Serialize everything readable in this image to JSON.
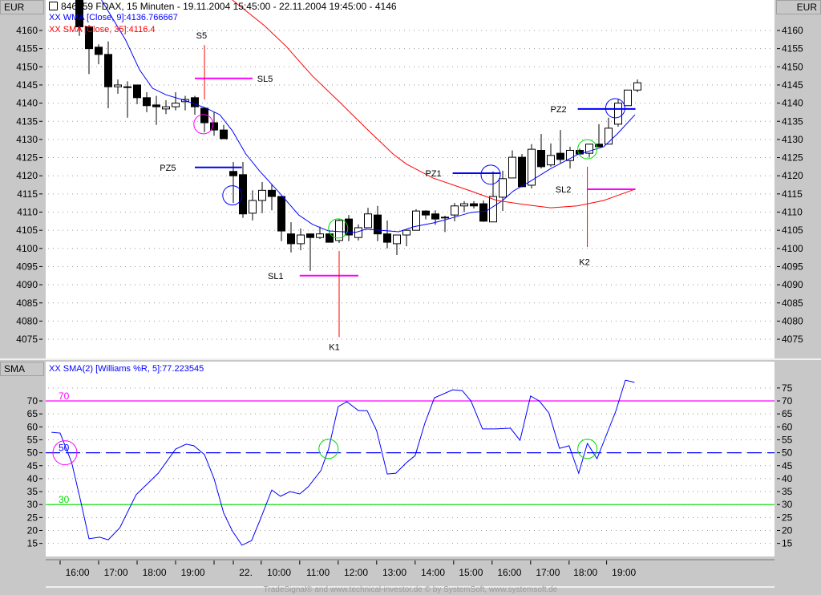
{
  "header": {
    "symbol_icon": "crosshair-icon",
    "title": "846959  FDAX, 15 Minuten - 19.11.2004 15:45:00 - 22.11.2004 19:45:00 - 4146",
    "wma_legend": "XX WMA [Close, 9]:4136.766667",
    "sma_legend": "XX SMA [Close, 35]:4116.4",
    "currency_left": "EUR",
    "currency_right": "EUR"
  },
  "lower_panel": {
    "label": "SMA",
    "legend": "XX SMA(2) [Williams %R, 5]:77.223545"
  },
  "footer": "TradeSignal® and www.technical-investor.de © by  SystemSoft, www.systemsoft.de",
  "colors": {
    "wma": "#0000ff",
    "sma": "#ff0000",
    "magenta": "#ff00ff",
    "green": "#00dd00",
    "blue": "#0000ff",
    "red": "#ff0000"
  },
  "chart_data": [
    {
      "type": "candlestick",
      "title": "FDAX, 15 Minuten",
      "ylabel": "EUR",
      "ylim": [
        4071,
        4168
      ],
      "yticks": [
        4160,
        4155,
        4150,
        4145,
        4140,
        4135,
        4130,
        4125,
        4120,
        4115,
        4110,
        4105,
        4100,
        4095,
        4090,
        4085,
        4080,
        4075
      ],
      "grid": true,
      "ohlc_fields": [
        "open",
        "high",
        "low",
        "close"
      ],
      "candles": [
        [
          4170,
          4172,
          4158.5,
          4161
        ],
        [
          4161,
          4161.5,
          4148,
          4155
        ],
        [
          4155.4,
          4156.2,
          4150.7,
          4153.4
        ],
        [
          4153.4,
          4157,
          4138.6,
          4144.5
        ],
        [
          4144.5,
          4146.5,
          4142.6,
          4145
        ],
        [
          4144.5,
          4146,
          4136,
          4144.5
        ],
        [
          4145,
          4145,
          4139.7,
          4141.5
        ],
        [
          4141.5,
          4143,
          4137.5,
          4139.3
        ],
        [
          4139.5,
          4142,
          4134,
          4139
        ],
        [
          4138.4,
          4140.8,
          4137,
          4139
        ],
        [
          4139,
          4143,
          4138,
          4140
        ],
        [
          4140.4,
          4142,
          4138,
          4141
        ],
        [
          4141.5,
          4142,
          4136.8,
          4139
        ],
        [
          4138.6,
          4138.6,
          4132,
          4134.6
        ],
        [
          4134.6,
          4137.5,
          4131,
          4132.6
        ],
        [
          4132.6,
          4134,
          4130.2,
          4130.2
        ],
        [
          4121.2,
          4123.8,
          4112.5,
          4120
        ],
        [
          4120.3,
          4123.8,
          4108.4,
          4109.5
        ],
        [
          4109.7,
          4116,
          4107.7,
          4113.2
        ],
        [
          4113.2,
          4118.3,
          4109.7,
          4116
        ],
        [
          4116,
          4117.6,
          4110.5,
          4114.3
        ],
        [
          4114.3,
          4114.3,
          4102,
          4104.8
        ],
        [
          4104,
          4107.2,
          4098.9,
          4101.3
        ],
        [
          4101.3,
          4105.5,
          4099.5,
          4103.7
        ],
        [
          4104,
          4104,
          4093.8,
          4103
        ],
        [
          4103,
          4106,
          4102.6,
          4104
        ],
        [
          4104,
          4105,
          4101.7,
          4101.7
        ],
        [
          4102.2,
          4108.1,
          4101.5,
          4107.7
        ],
        [
          4108.1,
          4109.2,
          4102,
          4103.7
        ],
        [
          4103,
          4106.6,
          4102.2,
          4105.7
        ],
        [
          4105.7,
          4111.2,
          4105.7,
          4109.5
        ],
        [
          4109.2,
          4111.7,
          4102,
          4104
        ],
        [
          4104,
          4107.7,
          4100,
          4101.7
        ],
        [
          4101.3,
          4103.7,
          4098.2,
          4103.7
        ],
        [
          4103.7,
          4105,
          4100.6,
          4105
        ],
        [
          4105,
          4110.8,
          4105,
          4110.3
        ],
        [
          4110.3,
          4110.5,
          4108,
          4109.2
        ],
        [
          4109.5,
          4110.5,
          4106.5,
          4108.1
        ],
        [
          4108.6,
          4109,
          4104.5,
          4108.6
        ],
        [
          4109.2,
          4112.5,
          4107.5,
          4111.7
        ],
        [
          4111.7,
          4113,
          4110,
          4112.3
        ],
        [
          4112.3,
          4113,
          4111,
          4111.7
        ],
        [
          4112.3,
          4113.2,
          4107.3,
          4107.5
        ],
        [
          4107.3,
          4121.2,
          4107.3,
          4114.3
        ],
        [
          4114.1,
          4121.4,
          4110.3,
          4119.2
        ],
        [
          4119.4,
          4127,
          4119.4,
          4125.1
        ],
        [
          4125.1,
          4126,
          4116.8,
          4117
        ],
        [
          4117.4,
          4128.7,
          4116.5,
          4127.3
        ],
        [
          4127,
          4131.5,
          4122,
          4122.5
        ],
        [
          4123,
          4128.9,
          4122.5,
          4125.6
        ],
        [
          4126.2,
          4132.6,
          4123.5,
          4124.5
        ],
        [
          4124.2,
          4128,
          4122,
          4127
        ],
        [
          4127,
          4127.5,
          4125.5,
          4126
        ],
        [
          4126.2,
          4128.7,
          4125,
          4128.7
        ],
        [
          4128.7,
          4134.2,
          4128,
          4128
        ],
        [
          4128.7,
          4136,
          4128.7,
          4133.1
        ],
        [
          4134.2,
          4141,
          4133.5,
          4140
        ],
        [
          4139.3,
          4143.6,
          4139.3,
          4143.6
        ],
        [
          4143.6,
          4146.5,
          4143,
          4145.6
        ]
      ],
      "series": [
        {
          "name": "WMA [Close, 9]",
          "color": "#0000ff",
          "points": [
            [
              2.3,
              4168.4
            ],
            [
              4.8,
              4157.4
            ],
            [
              6.25,
              4149.2
            ],
            [
              7.6,
              4144.1
            ],
            [
              9,
              4142.3
            ],
            [
              10.9,
              4140.8
            ],
            [
              13.2,
              4138.6
            ],
            [
              14.6,
              4136.8
            ],
            [
              15.9,
              4132.4
            ],
            [
              17.3,
              4126
            ],
            [
              18.7,
              4121.4
            ],
            [
              20.9,
              4115
            ],
            [
              22.8,
              4109.2
            ],
            [
              24.25,
              4106.6
            ],
            [
              25.9,
              4104.8
            ],
            [
              28.7,
              4104.4
            ],
            [
              29.8,
              4105.3
            ],
            [
              33.2,
              4104.6
            ],
            [
              34.8,
              4106
            ],
            [
              36.75,
              4107
            ],
            [
              37.8,
              4107.7
            ],
            [
              40.7,
              4109.9
            ],
            [
              42.3,
              4110.3
            ],
            [
              44,
              4113.2
            ],
            [
              45.1,
              4115.8
            ],
            [
              46.75,
              4118.3
            ],
            [
              49,
              4122
            ],
            [
              51.75,
              4125.8
            ],
            [
              54.5,
              4128
            ],
            [
              55.9,
              4131.5
            ],
            [
              57.75,
              4136.8
            ]
          ]
        },
        {
          "name": "SMA [Close, 35]",
          "color": "#ff0000",
          "points": [
            [
              15.9,
              4168.4
            ],
            [
              19.25,
              4161.3
            ],
            [
              21.5,
              4155.6
            ],
            [
              24.25,
              4147.4
            ],
            [
              27,
              4140.4
            ],
            [
              29.8,
              4133.1
            ],
            [
              32.6,
              4126
            ],
            [
              34,
              4123.2
            ],
            [
              36.75,
              4119.4
            ],
            [
              40.9,
              4115.6
            ],
            [
              43.4,
              4113.2
            ],
            [
              46.2,
              4112.1
            ],
            [
              49,
              4111.2
            ],
            [
              51.75,
              4111.7
            ],
            [
              54.5,
              4113.2
            ],
            [
              57.75,
              4116.3
            ]
          ]
        }
      ],
      "annotations": {
        "hlines": [
          {
            "label": "SL5",
            "color": "#ff00ff",
            "price": 4146.8,
            "from": 12,
            "to": 18,
            "label_at": [
              19.3,
              4146.8
            ]
          },
          {
            "label": "PZ5",
            "color": "#0000ff",
            "price": 4122.3,
            "from": 12,
            "to": 16.9,
            "label_at": [
              9.2,
              4122.3
            ]
          },
          {
            "label": "SL1",
            "color": "#ff00ff",
            "price": 4092.5,
            "from": 22.9,
            "to": 29,
            "label_at": [
              20.4,
              4092.5
            ]
          },
          {
            "label": "PZ1",
            "color": "#0000ff",
            "price": 4120.7,
            "from": 38.8,
            "to": 43.8,
            "label_at": [
              36.8,
              4120.7
            ]
          },
          {
            "label": "PZ2",
            "color": "#0000ff",
            "price": 4138.4,
            "from": 51.8,
            "to": 57.8,
            "label_at": [
              49.8,
              4138.4
            ]
          },
          {
            "label": "SL2",
            "color": "#ff00ff",
            "price": 4116.3,
            "from": 52.8,
            "to": 57.8,
            "label_at": [
              50.3,
              4116.3
            ]
          }
        ],
        "vlines": [
          {
            "label": "S5",
            "color": "#ff0000",
            "index": 13,
            "from": 4141,
            "to": 4156,
            "label_at": [
              12.7,
              4158.7
            ]
          },
          {
            "label": "K1",
            "color": "#ff0000",
            "index": 27,
            "from": 4075.6,
            "to": 4099.3,
            "label_at": [
              26.5,
              4072.9
            ]
          },
          {
            "label": "K2",
            "color": "#ff0000",
            "index": 52.8,
            "from": 4100.4,
            "to": 4122.5,
            "label_at": [
              52.5,
              4096.3
            ]
          }
        ],
        "circles": [
          {
            "color": "#ff00ff",
            "index": 12.9,
            "price": 4134.2
          },
          {
            "color": "#0000ff",
            "index": 15.9,
            "price": 4114.6
          },
          {
            "color": "#00dd00",
            "index": 26.9,
            "price": 4105.5
          },
          {
            "color": "#0000ff",
            "index": 42.75,
            "price": 4120.3
          },
          {
            "color": "#0000ff",
            "index": 55.7,
            "price": 4138.6
          },
          {
            "color": "#00dd00",
            "index": 52.8,
            "price": 4127.3
          }
        ]
      }
    },
    {
      "type": "line",
      "title": "SMA(2) [Williams %R, 5]",
      "ylim": [
        12,
        80
      ],
      "yticks_right": [
        75,
        70,
        65,
        60,
        55,
        50,
        45,
        40,
        35,
        30,
        25,
        20,
        15
      ],
      "yticks_left": [
        70,
        65,
        60,
        55,
        50,
        45,
        40,
        35,
        30,
        25,
        20,
        15
      ],
      "grid": true,
      "levels": [
        {
          "value": 70,
          "label": "70",
          "color": "#ff00ff",
          "style": "solid"
        },
        {
          "value": 50,
          "label": "50",
          "color": "#0000ff",
          "style": "dashed"
        },
        {
          "value": 30,
          "label": "30",
          "color": "#00dd00",
          "style": "solid"
        }
      ],
      "series": [
        {
          "name": "Williams %R SMA(2)",
          "color": "#0000ff",
          "points": [
            [
              -2.9,
              57.9
            ],
            [
              -2,
              57.6
            ],
            [
              -0.8,
              46.2
            ],
            [
              0.1,
              31.9
            ],
            [
              1,
              16.8
            ],
            [
              2.1,
              17.4
            ],
            [
              3,
              16.4
            ],
            [
              4.2,
              21
            ],
            [
              5.9,
              33.8
            ],
            [
              8.2,
              42.1
            ],
            [
              10,
              51.4
            ],
            [
              11.1,
              53.3
            ],
            [
              11.9,
              52.7
            ],
            [
              13,
              49.3
            ],
            [
              14,
              40
            ],
            [
              15,
              26.7
            ],
            [
              15.9,
              19.8
            ],
            [
              16.9,
              14.3
            ],
            [
              17.9,
              16.1
            ],
            [
              18.8,
              24.2
            ],
            [
              20,
              35.6
            ],
            [
              20.9,
              33.2
            ],
            [
              21.9,
              35
            ],
            [
              22.9,
              34.1
            ],
            [
              23.8,
              36.9
            ],
            [
              25.1,
              43.1
            ],
            [
              25.9,
              51.4
            ],
            [
              26.9,
              67.8
            ],
            [
              27.8,
              69.7
            ],
            [
              29,
              66.3
            ],
            [
              29.9,
              66.3
            ],
            [
              30.9,
              58.5
            ],
            [
              32,
              41.8
            ],
            [
              32.9,
              42.1
            ],
            [
              34,
              46.2
            ],
            [
              34.9,
              48.9
            ],
            [
              35.9,
              61.3
            ],
            [
              36.9,
              71.2
            ],
            [
              38.8,
              74.3
            ],
            [
              39.8,
              74
            ],
            [
              40.7,
              70
            ],
            [
              41.9,
              59.2
            ],
            [
              43.25,
              59.2
            ],
            [
              44.8,
              59.5
            ],
            [
              45.8,
              54.8
            ],
            [
              46.9,
              71.9
            ],
            [
              47.8,
              70
            ],
            [
              48.8,
              65.4
            ],
            [
              49.9,
              51.7
            ],
            [
              50.9,
              52.7
            ],
            [
              51.9,
              42.1
            ],
            [
              52.8,
              53.6
            ],
            [
              53.8,
              47.7
            ],
            [
              55.75,
              66
            ],
            [
              56.75,
              78
            ],
            [
              57.7,
              77.2
            ]
          ]
        }
      ],
      "circles": [
        {
          "color": "#ff00ff",
          "index": -1.5,
          "value": 50
        },
        {
          "color": "#00dd00",
          "index": 25.9,
          "value": 51.5
        },
        {
          "color": "#00dd00",
          "index": 52.8,
          "value": 51.5
        }
      ]
    }
  ],
  "time_axis": {
    "labels": [
      "16:00",
      "17:00",
      "18:00",
      "19:00",
      "22.",
      "10:00",
      "11:00",
      "12:00",
      "13:00",
      "14:00",
      "15:00",
      "16:00",
      "17:00",
      "18:00",
      "19:00"
    ],
    "label_index": [
      -0.2,
      3.8,
      7.8,
      11.8,
      17.3,
      20.75,
      24.8,
      28.75,
      32.75,
      36.75,
      40.7,
      44.7,
      48.7,
      52.6,
      56.6
    ],
    "tick_index": [
      -2,
      2,
      6,
      10,
      14,
      16,
      18.9,
      22.9,
      26.9,
      30.9,
      34.9,
      38.9,
      42.9,
      46.9,
      50.9,
      54.8
    ]
  }
}
